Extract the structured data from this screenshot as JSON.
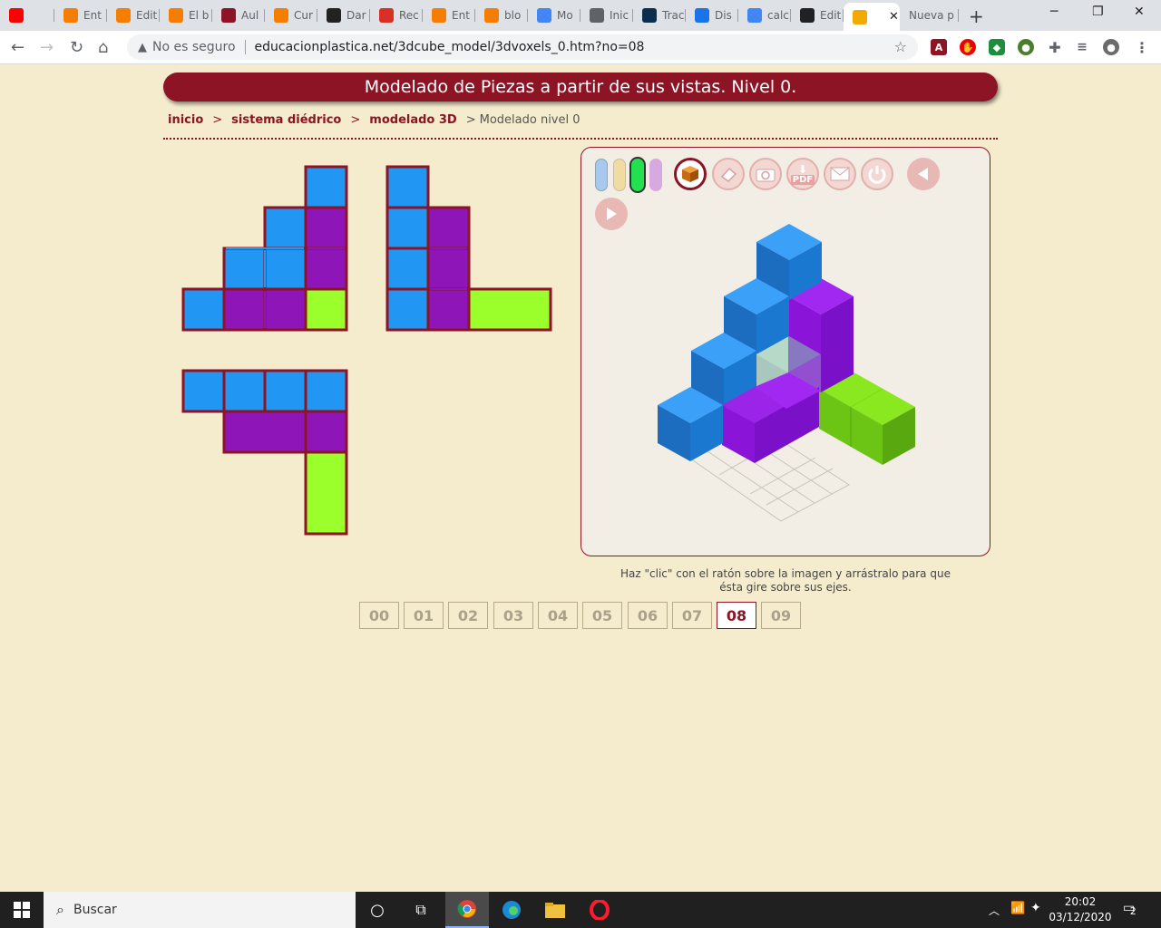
{
  "browser": {
    "tabs": [
      {
        "label": "",
        "icon": "youtube-icon",
        "color": "#ff0000"
      },
      {
        "label": "Ent",
        "icon": "blogger-icon",
        "color": "#f57d00"
      },
      {
        "label": "Edit",
        "icon": "blogger-icon",
        "color": "#f57d00"
      },
      {
        "label": "El b",
        "icon": "blogger-icon",
        "color": "#f57d00"
      },
      {
        "label": "Aul",
        "icon": "crest-icon",
        "color": "#8c1424"
      },
      {
        "label": "Cur",
        "icon": "info-icon",
        "color": "#f57d00"
      },
      {
        "label": "Dar",
        "icon": "e-icon",
        "color": "#222222"
      },
      {
        "label": "Rec",
        "icon": "gmail-icon",
        "color": "#d93025"
      },
      {
        "label": "Ent",
        "icon": "blogger-icon",
        "color": "#f57d00"
      },
      {
        "label": "blo",
        "icon": "blogger-icon",
        "color": "#f57d00"
      },
      {
        "label": "Mo",
        "icon": "chart-icon",
        "color": "#4285f4"
      },
      {
        "label": "Inic",
        "icon": "globe-icon",
        "color": "#5f6368"
      },
      {
        "label": "Trac",
        "icon": "translate-icon",
        "color": "#0b2e4f"
      },
      {
        "label": "Dis",
        "icon": "calendar-icon",
        "color": "#1a73e8"
      },
      {
        "label": "calc",
        "icon": "google-icon",
        "color": "#4285f4"
      },
      {
        "label": "Edit",
        "icon": "chrome-icon",
        "color": "#202124"
      },
      {
        "label": "",
        "icon": "cube-icon",
        "color": "#f2a900",
        "active": true
      },
      {
        "label": "Nueva p",
        "icon": "",
        "color": ""
      }
    ],
    "new_tab": "+",
    "window_controls": {
      "minimize": "─",
      "restore": "❐",
      "close": "✕"
    },
    "address": {
      "security": "No es seguro",
      "url": "educacionplastica.net/3dcube_model/3dvoxels_0.htm?no=08"
    }
  },
  "page": {
    "title": "Modelado de Piezas a partir de sus vistas. Nivel 0.",
    "breadcrumb": {
      "items": [
        "inicio",
        "sistema diédrico",
        "modelado 3D"
      ],
      "current": "Modelado nivel 0",
      "separator": ">"
    },
    "colors": {
      "brand": "#8c1424",
      "blue": "#2196f3",
      "purple": "#8e16b8",
      "green": "#9aff2a",
      "background": "#f5ecce"
    },
    "viewer": {
      "toolbar": [
        {
          "name": "cube-icon",
          "label": ""
        },
        {
          "name": "eraser-icon",
          "label": ""
        },
        {
          "name": "camera-icon",
          "label": ""
        },
        {
          "name": "pdf-download-icon",
          "label": "PDF"
        },
        {
          "name": "mail-icon",
          "label": ""
        },
        {
          "name": "power-icon",
          "label": ""
        },
        {
          "name": "previous-icon",
          "label": ""
        },
        {
          "name": "next-icon",
          "label": ""
        }
      ],
      "palette": [
        "#a8c8f0",
        "#f0dca0",
        "#22e050",
        "#d8a8e0"
      ],
      "hint": "Haz \"clic\" con el ratón sobre la imagen y arrástralo para que ésta gire sobre sus ejes."
    },
    "pager": {
      "pages": [
        "00",
        "01",
        "02",
        "03",
        "04",
        "05",
        "06",
        "07",
        "08",
        "09"
      ],
      "current": "08"
    }
  },
  "taskbar": {
    "search_placeholder": "Buscar",
    "time": "20:02",
    "date": "03/12/2020",
    "notifications": "2"
  }
}
